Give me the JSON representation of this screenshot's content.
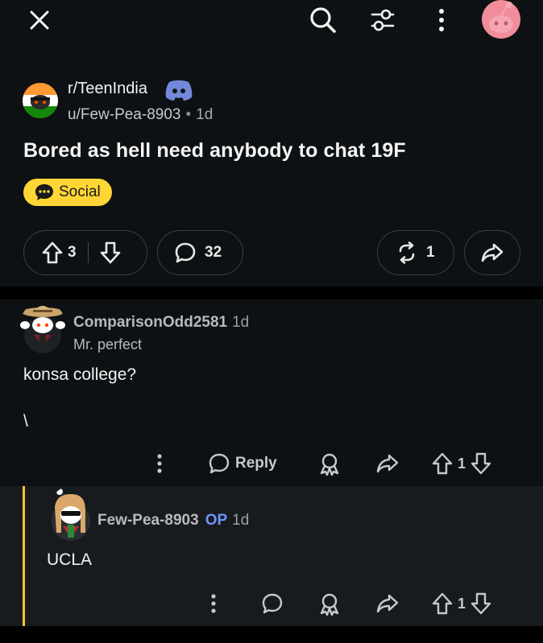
{
  "topbar": {
    "close_icon": "close-icon",
    "search_icon": "search-icon",
    "filter_icon": "sort-filter-icon",
    "more_icon": "more-vertical-icon",
    "avatar_color": "#f28b9a"
  },
  "post": {
    "subreddit": "r/TeenIndia",
    "author": "u/Few-Pea-8903",
    "age": "1d",
    "title": "Bored as hell need anybody to chat 19F",
    "flair": "Social",
    "flair_color": "#ffd635",
    "upvotes": "3",
    "comments": "32",
    "crossposts": "1"
  },
  "comments": [
    {
      "author": "ComparisonOdd2581",
      "age": "1d",
      "flair": "Mr. perfect",
      "body_line1": "konsa college?",
      "body_line2": "\\",
      "reply_label": "Reply",
      "score": "1"
    },
    {
      "author": "Few-Pea-8903",
      "op_label": "OP",
      "age": "1d",
      "body": "UCLA",
      "score": "1"
    }
  ],
  "colors": {
    "background": "#0e1113",
    "op_blue": "#7193ff",
    "thread_line": "#f6c12e"
  }
}
